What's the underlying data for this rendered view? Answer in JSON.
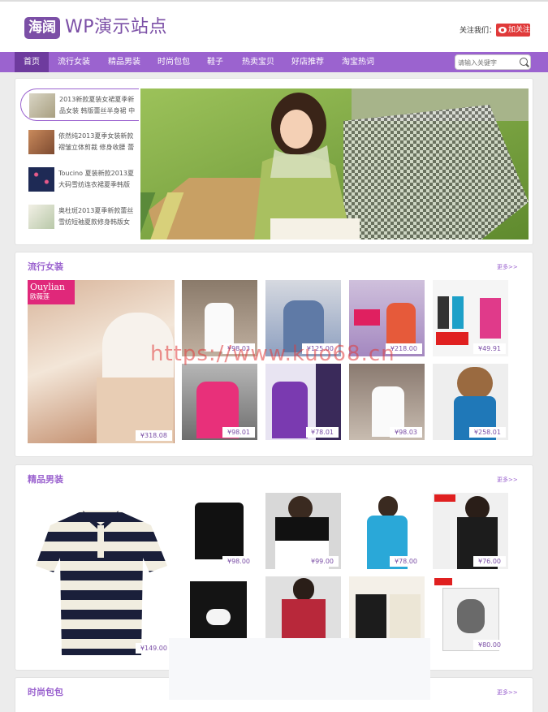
{
  "header": {
    "logo": "海阔",
    "site_title": "WP演示站点",
    "follow_label": "关注我们：",
    "follow_btn": "加关注"
  },
  "nav": {
    "items": [
      "首页",
      "流行女装",
      "精品男装",
      "时尚包包",
      "鞋子",
      "热卖宝贝",
      "好店推荐",
      "淘宝热词"
    ],
    "search_placeholder": "请输入关键字"
  },
  "slider": {
    "items": [
      "2013新款夏装女裙夏季新品女装 韩版蕾丝半身裙 中",
      "依然纯2013夏季女装新款 褶皱立体剪裁 修身收腰 蕾",
      "Toucino 夏装新款2013夏 大码雪纺连衣裙夏季韩版",
      "奥杜斑2013夏季新款蕾丝 雪纺短袖夏款修身韩版女"
    ]
  },
  "sections": [
    {
      "title": "流行女装",
      "more": "更多>>",
      "big_price": "¥318.08",
      "big_brand": "Ouylian",
      "big_brand_cn": "欧薇莲",
      "tiles": [
        "¥98.03",
        "¥125.00",
        "¥218.00",
        "¥49.91",
        "¥98.01",
        "¥78.01",
        "¥98.03",
        "¥258.01"
      ]
    },
    {
      "title": "精品男装",
      "more": "更多>>",
      "big_price": "¥149.00",
      "tiles": [
        "¥98.00",
        "¥99.00",
        "¥78.00",
        "¥76.00",
        "",
        "",
        "",
        "¥80.00"
      ]
    },
    {
      "title": "时尚包包",
      "more": "更多>>"
    }
  ],
  "watermark": "https://www.kuo68.cn",
  "colors": {
    "brand": "#9b63cf",
    "brand_dark": "#6e3b9e",
    "follow": "#e03a3a"
  }
}
